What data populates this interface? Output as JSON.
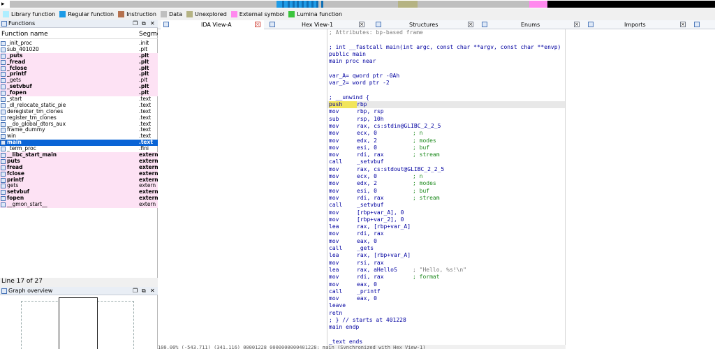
{
  "nav": {
    "arrow": "▸",
    "segments": [
      {
        "w": 382,
        "color": "#bfbfbf"
      },
      {
        "w": 60,
        "color": "#1e9be6"
      },
      {
        "w": 114,
        "color": "#bfbfbf"
      },
      {
        "w": 28,
        "color": "#b5b383"
      },
      {
        "w": 160,
        "color": "#bfbfbf"
      },
      {
        "w": 26,
        "color": "#ff88ee"
      },
      {
        "w": 240,
        "color": "#000000"
      }
    ]
  },
  "legend": [
    {
      "label": "Library function",
      "color": "#aeeeff"
    },
    {
      "label": "Regular function",
      "color": "#1e9be6"
    },
    {
      "label": "Instruction",
      "color": "#b5714e"
    },
    {
      "label": "Data",
      "color": "#bfbfbf"
    },
    {
      "label": "Unexplored",
      "color": "#b5b383"
    },
    {
      "label": "External symbol",
      "color": "#ff88ee"
    },
    {
      "label": "Lumina function",
      "color": "#3ac43a"
    }
  ],
  "functions_panel": {
    "title": "Functions",
    "col_name": "Function name",
    "col_segment": "Segme",
    "rows": [
      {
        "name": "_init_proc",
        "seg": ".init",
        "style": ""
      },
      {
        "name": "sub_401020",
        "seg": ".plt",
        "style": ""
      },
      {
        "name": "_puts",
        "seg": ".plt",
        "style": "lib bold"
      },
      {
        "name": "_fread",
        "seg": ".plt",
        "style": "lib bold"
      },
      {
        "name": "_fclose",
        "seg": ".plt",
        "style": "lib bold"
      },
      {
        "name": "_printf",
        "seg": ".plt",
        "style": "lib bold"
      },
      {
        "name": "_gets",
        "seg": ".plt",
        "style": "lib"
      },
      {
        "name": "_setvbuf",
        "seg": ".plt",
        "style": "lib bold"
      },
      {
        "name": "_fopen",
        "seg": ".plt",
        "style": "lib bold"
      },
      {
        "name": "_start",
        "seg": ".text",
        "style": ""
      },
      {
        "name": "_dl_relocate_static_pie",
        "seg": ".text",
        "style": ""
      },
      {
        "name": "deregister_tm_clones",
        "seg": ".text",
        "style": ""
      },
      {
        "name": "register_tm_clones",
        "seg": ".text",
        "style": ""
      },
      {
        "name": "__do_global_dtors_aux",
        "seg": ".text",
        "style": ""
      },
      {
        "name": "frame_dummy",
        "seg": ".text",
        "style": ""
      },
      {
        "name": "win",
        "seg": ".text",
        "style": ""
      },
      {
        "name": "main",
        "seg": ".text",
        "style": "sel bold"
      },
      {
        "name": "_term_proc",
        "seg": ".fini",
        "style": ""
      },
      {
        "name": "__libc_start_main",
        "seg": "extern",
        "style": "lib bold"
      },
      {
        "name": "puts",
        "seg": "extern",
        "style": "lib bold"
      },
      {
        "name": "fread",
        "seg": "extern",
        "style": "lib bold"
      },
      {
        "name": "fclose",
        "seg": "extern",
        "style": "lib bold"
      },
      {
        "name": "printf",
        "seg": "extern",
        "style": "lib bold"
      },
      {
        "name": "gets",
        "seg": "extern",
        "style": "lib"
      },
      {
        "name": "setvbuf",
        "seg": "extern",
        "style": "lib bold"
      },
      {
        "name": "fopen",
        "seg": "extern",
        "style": "lib bold"
      },
      {
        "name": "__gmon_start__",
        "seg": "extern",
        "style": "lib"
      }
    ],
    "status": "Line 17 of 27"
  },
  "graph_panel": {
    "title": "Graph overview"
  },
  "tabs": [
    {
      "label": "IDA View-A",
      "active": true
    },
    {
      "label": "Hex View-1",
      "active": false
    },
    {
      "label": "Structures",
      "active": false
    },
    {
      "label": "Enums",
      "active": false
    },
    {
      "label": "Imports",
      "active": false
    }
  ],
  "disasm": [
    {
      "t": "; Attributes: bp-based frame",
      "c": "comment"
    },
    {
      "t": "",
      "c": ""
    },
    {
      "t": "; int __fastcall main(int argc, const char **argv, const char **envp)",
      "c": ""
    },
    {
      "t": "public main",
      "c": ""
    },
    {
      "t": "main proc near",
      "c": ""
    },
    {
      "t": "",
      "c": ""
    },
    {
      "t": "var_A= qword ptr -0Ah",
      "c": ""
    },
    {
      "t": "var_2= word ptr -2",
      "c": ""
    },
    {
      "t": "",
      "c": ""
    },
    {
      "t": "; __unwind {",
      "c": ""
    },
    {
      "m": "push",
      "o": "rbp",
      "cm": "",
      "c": "hl",
      "p": true
    },
    {
      "m": "mov",
      "o": "rbp, rsp",
      "cm": ""
    },
    {
      "m": "sub",
      "o": "rsp, 10h",
      "cm": ""
    },
    {
      "m": "mov",
      "o": "rax, cs:stdin@GLIBC_2_2_5",
      "cm": ""
    },
    {
      "m": "mov",
      "o": "ecx, 0",
      "cm": "; n"
    },
    {
      "m": "mov",
      "o": "edx, 2",
      "cm": "; modes"
    },
    {
      "m": "mov",
      "o": "esi, 0",
      "cm": "; buf"
    },
    {
      "m": "mov",
      "o": "rdi, rax",
      "cm": "; stream"
    },
    {
      "m": "call",
      "o": "_setvbuf",
      "cm": ""
    },
    {
      "m": "mov",
      "o": "rax, cs:stdout@GLIBC_2_2_5",
      "cm": ""
    },
    {
      "m": "mov",
      "o": "ecx, 0",
      "cm": "; n"
    },
    {
      "m": "mov",
      "o": "edx, 2",
      "cm": "; modes"
    },
    {
      "m": "mov",
      "o": "esi, 0",
      "cm": "; buf"
    },
    {
      "m": "mov",
      "o": "rdi, rax",
      "cm": "; stream"
    },
    {
      "m": "call",
      "o": "_setvbuf",
      "cm": ""
    },
    {
      "m": "mov",
      "o": "[rbp+var_A], 0",
      "cm": ""
    },
    {
      "m": "mov",
      "o": "[rbp+var_2], 0",
      "cm": ""
    },
    {
      "m": "lea",
      "o": "rax, [rbp+var_A]",
      "cm": ""
    },
    {
      "m": "mov",
      "o": "rdi, rax",
      "cm": ""
    },
    {
      "m": "mov",
      "o": "eax, 0",
      "cm": ""
    },
    {
      "m": "call",
      "o": "_gets",
      "cm": ""
    },
    {
      "m": "lea",
      "o": "rax, [rbp+var_A]",
      "cm": ""
    },
    {
      "m": "mov",
      "o": "rsi, rax",
      "cm": ""
    },
    {
      "m": "lea",
      "o": "rax, aHelloS",
      "cm": "",
      "s": "; \"Hello, %s!\\n\""
    },
    {
      "m": "mov",
      "o": "rdi, rax",
      "cm": "; format"
    },
    {
      "m": "mov",
      "o": "eax, 0",
      "cm": ""
    },
    {
      "m": "call",
      "o": "_printf",
      "cm": ""
    },
    {
      "m": "mov",
      "o": "eax, 0",
      "cm": ""
    },
    {
      "m": "leave",
      "o": "",
      "cm": ""
    },
    {
      "m": "retn",
      "o": "",
      "cm": ""
    },
    {
      "t": "; } // starts at 401228",
      "c": ""
    },
    {
      "t": "main endp",
      "c": ""
    },
    {
      "t": "",
      "c": ""
    },
    {
      "t": "_text ends",
      "c": ""
    }
  ],
  "bottom_status": "100.00% (-543,711) (341,116) 00001228 0000000000401228: main (Synchronized with Hex View-1)"
}
